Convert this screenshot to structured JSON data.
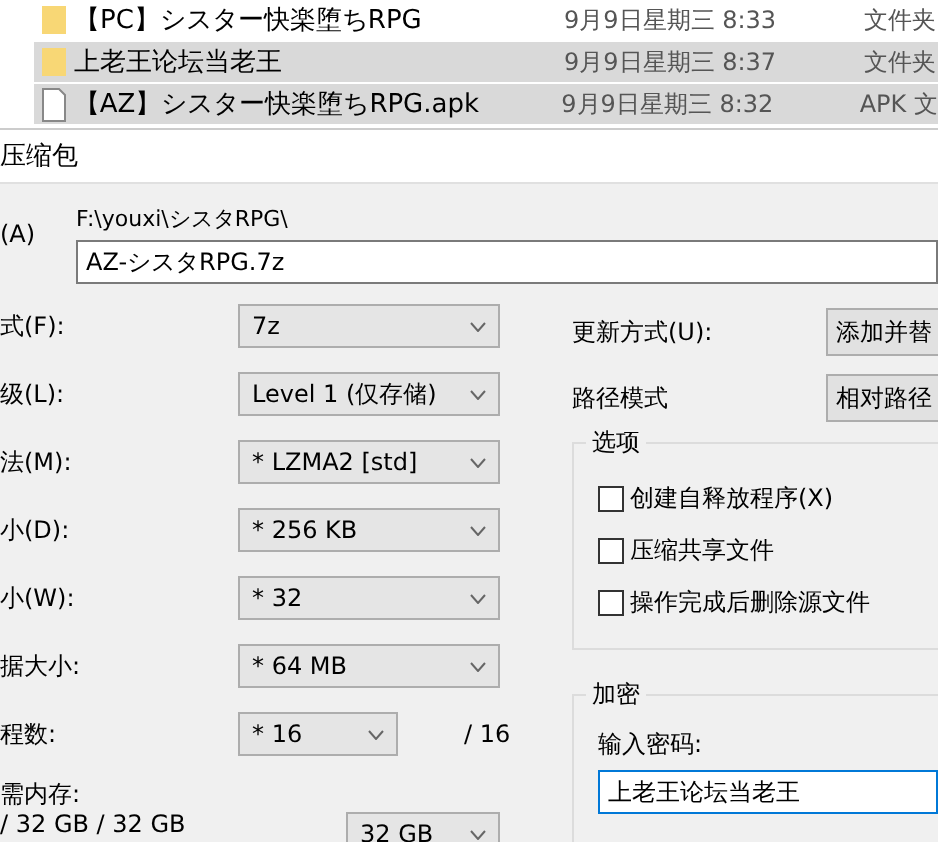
{
  "file_list": {
    "rows": [
      {
        "kind": "folder",
        "name": "【PC】シスター快楽堕ちRPG",
        "date": "9月9日星期三 8:33",
        "type": "文件夹",
        "selected": false
      },
      {
        "kind": "folder",
        "name": "上老王论坛当老王",
        "date": "9月9日星期三 8:37",
        "type": "文件夹",
        "selected": true
      },
      {
        "kind": "file",
        "name": "【AZ】シスター快楽堕ちRPG.apk",
        "date": "9月9日星期三 8:32",
        "type": "APK 文",
        "selected": true
      }
    ]
  },
  "dialog": {
    "title": "压缩包",
    "archive": {
      "label": "(A)",
      "path": "F:\\youxi\\シスタRPG\\",
      "value": "AZ-シスタRPG.7z"
    },
    "settings": [
      {
        "label": "式(F):",
        "value": "7z"
      },
      {
        "label": "级(L):",
        "value": "Level 1 (仅存储)"
      },
      {
        "label": "法(M):",
        "value": "* LZMA2 [std]"
      },
      {
        "label": "小(D):",
        "value": "* 256 KB"
      },
      {
        "label": "小(W):",
        "value": "* 32"
      },
      {
        "label": "据大小:",
        "value": "* 64 MB"
      },
      {
        "label": "程数:",
        "value": "* 16",
        "suffix": "/ 16"
      }
    ],
    "memory": {
      "label": "需内存:",
      "reading": "/ 32 GB / 32 GB",
      "value": "32 GB"
    },
    "update_mode": {
      "label": "更新方式(U):",
      "value": "添加并替"
    },
    "path_mode": {
      "label": "路径模式",
      "value": "相对路径"
    },
    "options": {
      "title": "选项",
      "items": [
        {
          "label": "创建自释放程序(X)",
          "checked": false
        },
        {
          "label": "压缩共享文件",
          "checked": false
        },
        {
          "label": "操作完成后删除源文件",
          "checked": false
        }
      ]
    },
    "encryption": {
      "title": "加密",
      "label": "输入密码:",
      "value": "上老王论坛当老王"
    }
  }
}
